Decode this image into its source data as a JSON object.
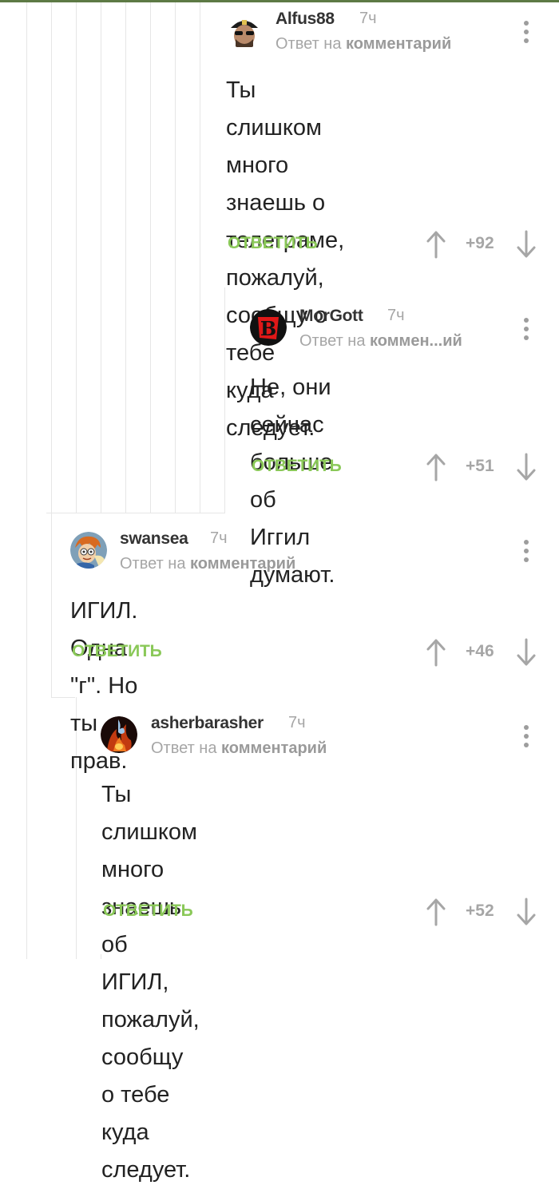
{
  "colors": {
    "accent": "#8ac858",
    "muted": "#a6a6a6",
    "text": "#222222",
    "topbar": "#5d7a45"
  },
  "comments": [
    {
      "username": "Alfus88",
      "time": "7ч",
      "reply_prefix": "Ответ на",
      "reply_target": "комментарий",
      "text": "Ты слишком много\nзнаешь о телеграме,\nпожалуй, сообщу о тебе\nкуда следует.",
      "reply_label": "ОТВЕТИТЬ",
      "rating": "+92",
      "avatar_icon": "avatar-sunglasses-cap"
    },
    {
      "username": "MorGott",
      "time": "7ч",
      "reply_prefix": "Ответ на",
      "reply_target": "коммен...ий",
      "text": "Не, они сейчас больше\nоб Иггил думают.",
      "reply_label": "ОТВЕТИТЬ",
      "rating": "+51",
      "avatar_icon": "avatar-red-b-logo"
    },
    {
      "username": "swansea",
      "time": "7ч",
      "reply_prefix": "Ответ на",
      "reply_target": "комментарий",
      "text": "ИГИЛ. Одна \"г\". Но ты прав.",
      "reply_label": "ОТВЕТИТЬ",
      "rating": "+46",
      "avatar_icon": "avatar-cartoon-character"
    },
    {
      "username": "asherbarasher",
      "time": "7ч",
      "reply_prefix": "Ответ на",
      "reply_target": "комментарий",
      "text": "Ты слишком много знаешь об\nИГИЛ, пожалуй, сообщу о тебе\nкуда следует.",
      "reply_label": "ОТВЕТИТЬ",
      "rating": "+52",
      "avatar_icon": "avatar-fire-figure"
    }
  ]
}
